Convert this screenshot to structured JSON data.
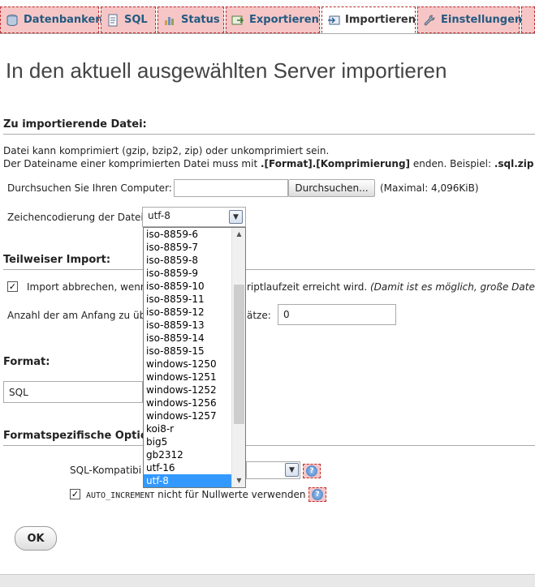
{
  "tabs": [
    {
      "label": "Datenbanken",
      "icon": "database-icon"
    },
    {
      "label": "SQL",
      "icon": "sql-document-icon"
    },
    {
      "label": "Status",
      "icon": "status-chart-icon"
    },
    {
      "label": "Exportieren",
      "icon": "export-icon"
    },
    {
      "label": "Importieren",
      "icon": "import-icon",
      "active": true
    },
    {
      "label": "Einstellungen",
      "icon": "wrench-icon"
    }
  ],
  "page_title": "In den aktuell ausgewählten Server importieren",
  "file_section": {
    "heading": "Zu importierende Datei:",
    "line1": "Datei kann komprimiert (gzip, bzip2, zip) oder unkomprimiert sein.",
    "line2_a": "Der Dateiname einer komprimierten Datei muss mit ",
    "line2_b": ".[Format].[Komprimierung]",
    "line2_c": " enden. Beispiel: ",
    "line2_d": ".sql.zip",
    "browse_label": "Durchsuchen Sie Ihren Computer:",
    "browse_button": "Durchsuchen...",
    "max_size": "(Maximal: 4,096KiB)",
    "charset_label": "Zeichencodierung der Datei:",
    "charset_value": "utf-8"
  },
  "charset_options": [
    "iso-8859-6",
    "iso-8859-7",
    "iso-8859-8",
    "iso-8859-9",
    "iso-8859-10",
    "iso-8859-11",
    "iso-8859-12",
    "iso-8859-13",
    "iso-8859-14",
    "iso-8859-15",
    "windows-1250",
    "windows-1251",
    "windows-1252",
    "windows-1256",
    "windows-1257",
    "koi8-r",
    "big5",
    "gb2312",
    "utf-16",
    "utf-8"
  ],
  "partial_section": {
    "heading": "Teilweiser Import:",
    "abort_label_a": "Import abbrechen, wenn",
    "abort_label_b": "riptlaufzeit erreicht wird. ",
    "abort_label_c": "(Damit ist es möglich, große Dateien",
    "abort_checked": true,
    "skip_label_a": "Anzahl der am Anfang zu übe",
    "skip_label_b": "ätze:",
    "skip_value": "0"
  },
  "format_section": {
    "heading": "Format:",
    "value": "SQL"
  },
  "options_section": {
    "heading": "Formatspezifische Optio",
    "compat_label": "SQL-Kompatibi",
    "auto_increment_code": "AUTO_INCREMENT",
    "auto_increment_text": " nicht für Nullwerte verwenden",
    "auto_increment_checked": true
  },
  "ok_button": "OK"
}
